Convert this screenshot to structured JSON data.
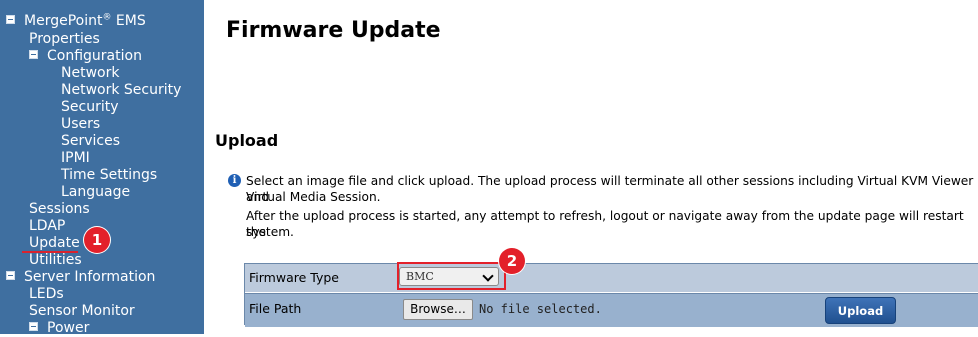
{
  "sidebar": {
    "root": {
      "label": "MergePoint",
      "sup": "®",
      "suffix": " EMS"
    },
    "properties": "Properties",
    "configuration": "Configuration",
    "network": "Network",
    "network_security": "Network Security",
    "security": "Security",
    "users": "Users",
    "services": "Services",
    "ipmi": "IPMI",
    "time_settings": "Time Settings",
    "language": "Language",
    "sessions": "Sessions",
    "ldap": "LDAP",
    "update": "Update",
    "utilities": "Utilities",
    "server_information": "Server Information",
    "leds": "LEDs",
    "sensor_monitor": "Sensor Monitor",
    "power": "Power"
  },
  "markers": {
    "one": "1",
    "two": "2"
  },
  "main": {
    "title": "Firmware Update",
    "section": "Upload",
    "info_line1": "Select an image file and click upload. The upload process will terminate all other sessions including Virtual KVM Viewer and",
    "info_line2": "Virtual Media Session.",
    "info_line3": "After the upload process is started, any attempt to refresh, logout or navigate away from the update page will restart the",
    "info_line4": "system.",
    "firmware_type_label": "Firmware Type",
    "firmware_type_value": "BMC",
    "file_path_label": "File Path",
    "browse_label": "Browse…",
    "no_file_text": "No file selected.",
    "upload_label": "Upload"
  },
  "colors": {
    "sidebar_bg": "#3f6fa0",
    "annotation_red": "#e3202a",
    "row_light": "#bccadc",
    "row_dark": "#98b1ce"
  }
}
